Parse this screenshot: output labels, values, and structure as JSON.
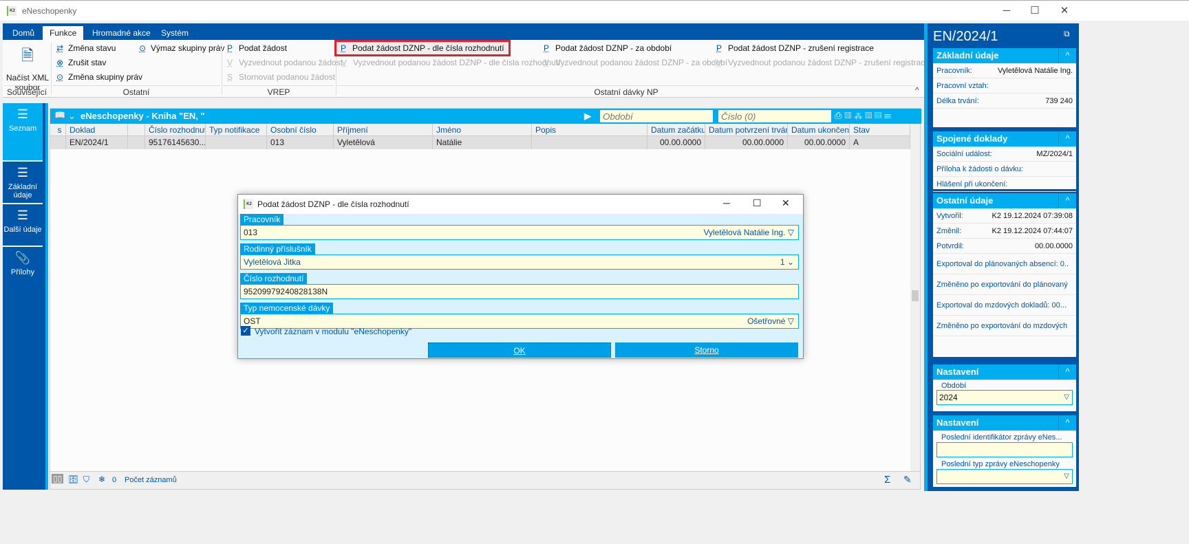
{
  "window": {
    "title": "eNeschopenky",
    "logo": "K2"
  },
  "ribbon": {
    "tabs": [
      "Domů",
      "Funkce",
      "Hromadné akce",
      "Systém"
    ],
    "active_tab": "Funkce",
    "souvisejici": {
      "load_xml": "Načíst XML soubor",
      "label": "Související"
    },
    "ostatni": {
      "items": [
        "Změna stavu",
        "Zrušit stav",
        "Změna skupiny práv",
        "Výmaz skupiny práv"
      ],
      "label": "Ostatní"
    },
    "vrep": {
      "items": [
        "Podat žádost",
        "Vyzvednout podanou žádost",
        "Stornovat podanou žádost"
      ],
      "label": "VREP"
    },
    "ostatni_davky": {
      "label": "Ostatní dávky NP",
      "items": [
        {
          "top": "Podat žádost DZNP - dle čísla rozhodnutí",
          "bottom": "Vyzvednout podanou žádost DZNP - dle čísla rozhodnutí"
        },
        {
          "top": "Podat žádost DZNP - za období",
          "bottom": "Vyzvednout podanou žádost DZNP - za období"
        },
        {
          "top": "Podat žádost DZNP - zrušení registrace",
          "bottom": "Vyzvednout podanou žádost DZNP - zrušení registrace"
        }
      ]
    },
    "highlight_color": "#e8202a"
  },
  "left_nav": [
    {
      "label": "Seznam",
      "icon": "list-icon"
    },
    {
      "label": "Základní údaje",
      "icon": "list-icon"
    },
    {
      "label": "Další údaje",
      "icon": "list-icon"
    },
    {
      "label": "Přílohy",
      "icon": "paperclip-icon"
    }
  ],
  "grid": {
    "title": "eNeschopenky - Kniha \"EN, \"",
    "period_placeholder": "Období",
    "number_placeholder": "Číslo (0)",
    "columns": [
      "s",
      "Doklad",
      "",
      "Číslo rozhodnutí",
      "Typ notifikace",
      "Osobní číslo",
      "Příjmení",
      "Jméno",
      "Popis",
      "Datum začátku",
      "Datum potvrzení trvání",
      "Datum ukončení",
      "Stav"
    ],
    "rows": [
      [
        "",
        "EN/2024/1",
        "",
        "95176145630...",
        "",
        "013",
        "Vyletělová",
        "Natálie",
        "",
        "00.00.0000",
        "00.00.0000",
        "00.00.0000",
        "A"
      ]
    ],
    "footer": {
      "count": "0",
      "count_label": "Počet záznamů"
    }
  },
  "right": {
    "title": "EN/2024/1",
    "zakladni": {
      "title": "Základní údaje",
      "fields": [
        [
          "Pracovník:",
          "Vyletělová Natálie Ing."
        ],
        [
          "Pracovní vztah:",
          ""
        ],
        [
          "Délka trvání:",
          "739 240"
        ]
      ]
    },
    "spojene": {
      "title": "Spojené doklady",
      "fields": [
        [
          "Sociální událost:",
          "MZ/2024/1"
        ],
        [
          "Příloha k žádosti o dávku:",
          ""
        ],
        [
          "Hlášení při ukončení:",
          ""
        ]
      ]
    },
    "ostatni": {
      "title": "Ostatní údaje",
      "fields": [
        [
          "Vytvořil:",
          "K2 19.12.2024 07:39:08"
        ],
        [
          "Změnil:",
          "K2 19.12.2024 07:44:07"
        ],
        [
          "Potvrdil:",
          "00.00.0000"
        ],
        [
          "Exportoval do plánovaných absencí: 0..",
          ""
        ],
        [
          "Změněno po exportování do plánovaný",
          ""
        ],
        [
          "Exportoval do mzdových dokladů: 00...",
          ""
        ],
        [
          "Změněno po exportování do mzdových",
          ""
        ]
      ]
    },
    "nastaveni1": {
      "title": "Nastavení",
      "label": "Období",
      "value": "2024"
    },
    "nastaveni2": {
      "title": "Nastavení",
      "label1": "Poslední identifikátor zprávy eNes...",
      "value1": "",
      "label2": "Poslední typ zprávy eNeschopenky",
      "value2": ""
    }
  },
  "dialog": {
    "title": "Podat žádost DZNP - dle čísla rozhodnutí",
    "fields": [
      {
        "label": "Pracovník",
        "value": "013",
        "right": "Vyletělová Natálie Ing."
      },
      {
        "label": "Rodinný příslušník",
        "value": "Vyletělová Jitka",
        "right": "1"
      },
      {
        "label": "Číslo rozhodnutí",
        "value": "95209979240828138N",
        "right": ""
      },
      {
        "label": "Typ nemocenské dávky",
        "value": "OST",
        "right": "Ošetřovné"
      }
    ],
    "checkbox": {
      "label": "Vytvořit záznam v modulu \"eNeschopenky\"",
      "checked": true
    },
    "ok": "OK",
    "cancel": "Storno"
  }
}
